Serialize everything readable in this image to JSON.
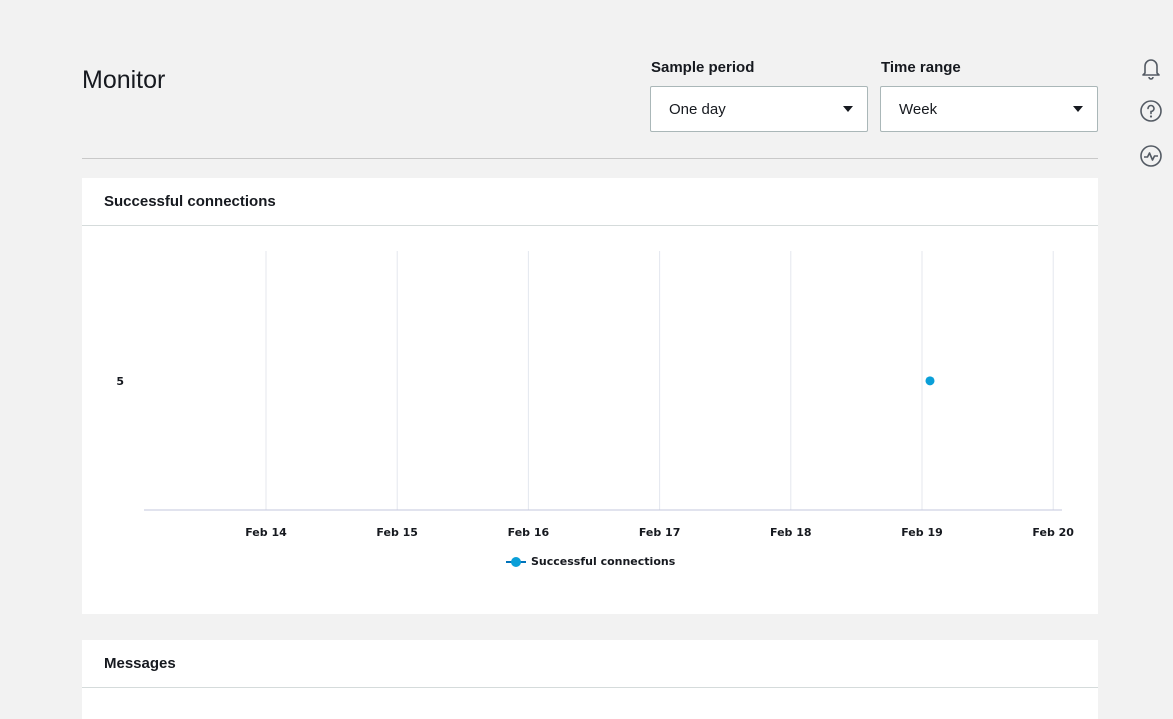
{
  "page": {
    "title": "Monitor"
  },
  "controls": {
    "sample_period": {
      "label": "Sample period",
      "value": "One day"
    },
    "time_range": {
      "label": "Time range",
      "value": "Week"
    }
  },
  "side_icons": [
    "bell-icon",
    "help-icon",
    "activity-icon"
  ],
  "panels": {
    "connections": {
      "title": "Successful connections"
    },
    "messages": {
      "title": "Messages"
    }
  },
  "chart_data": {
    "type": "scatter",
    "categories": [
      "Feb 14",
      "Feb 15",
      "Feb 16",
      "Feb 17",
      "Feb 18",
      "Feb 19",
      "Feb 20"
    ],
    "y_ticks": [
      5
    ],
    "series": [
      {
        "name": "Successful connections",
        "color": "#0a9fd8",
        "points": [
          {
            "x": "Feb 19",
            "y": 5
          }
        ]
      }
    ],
    "legend_position": "bottom-center",
    "grid": "vertical"
  }
}
